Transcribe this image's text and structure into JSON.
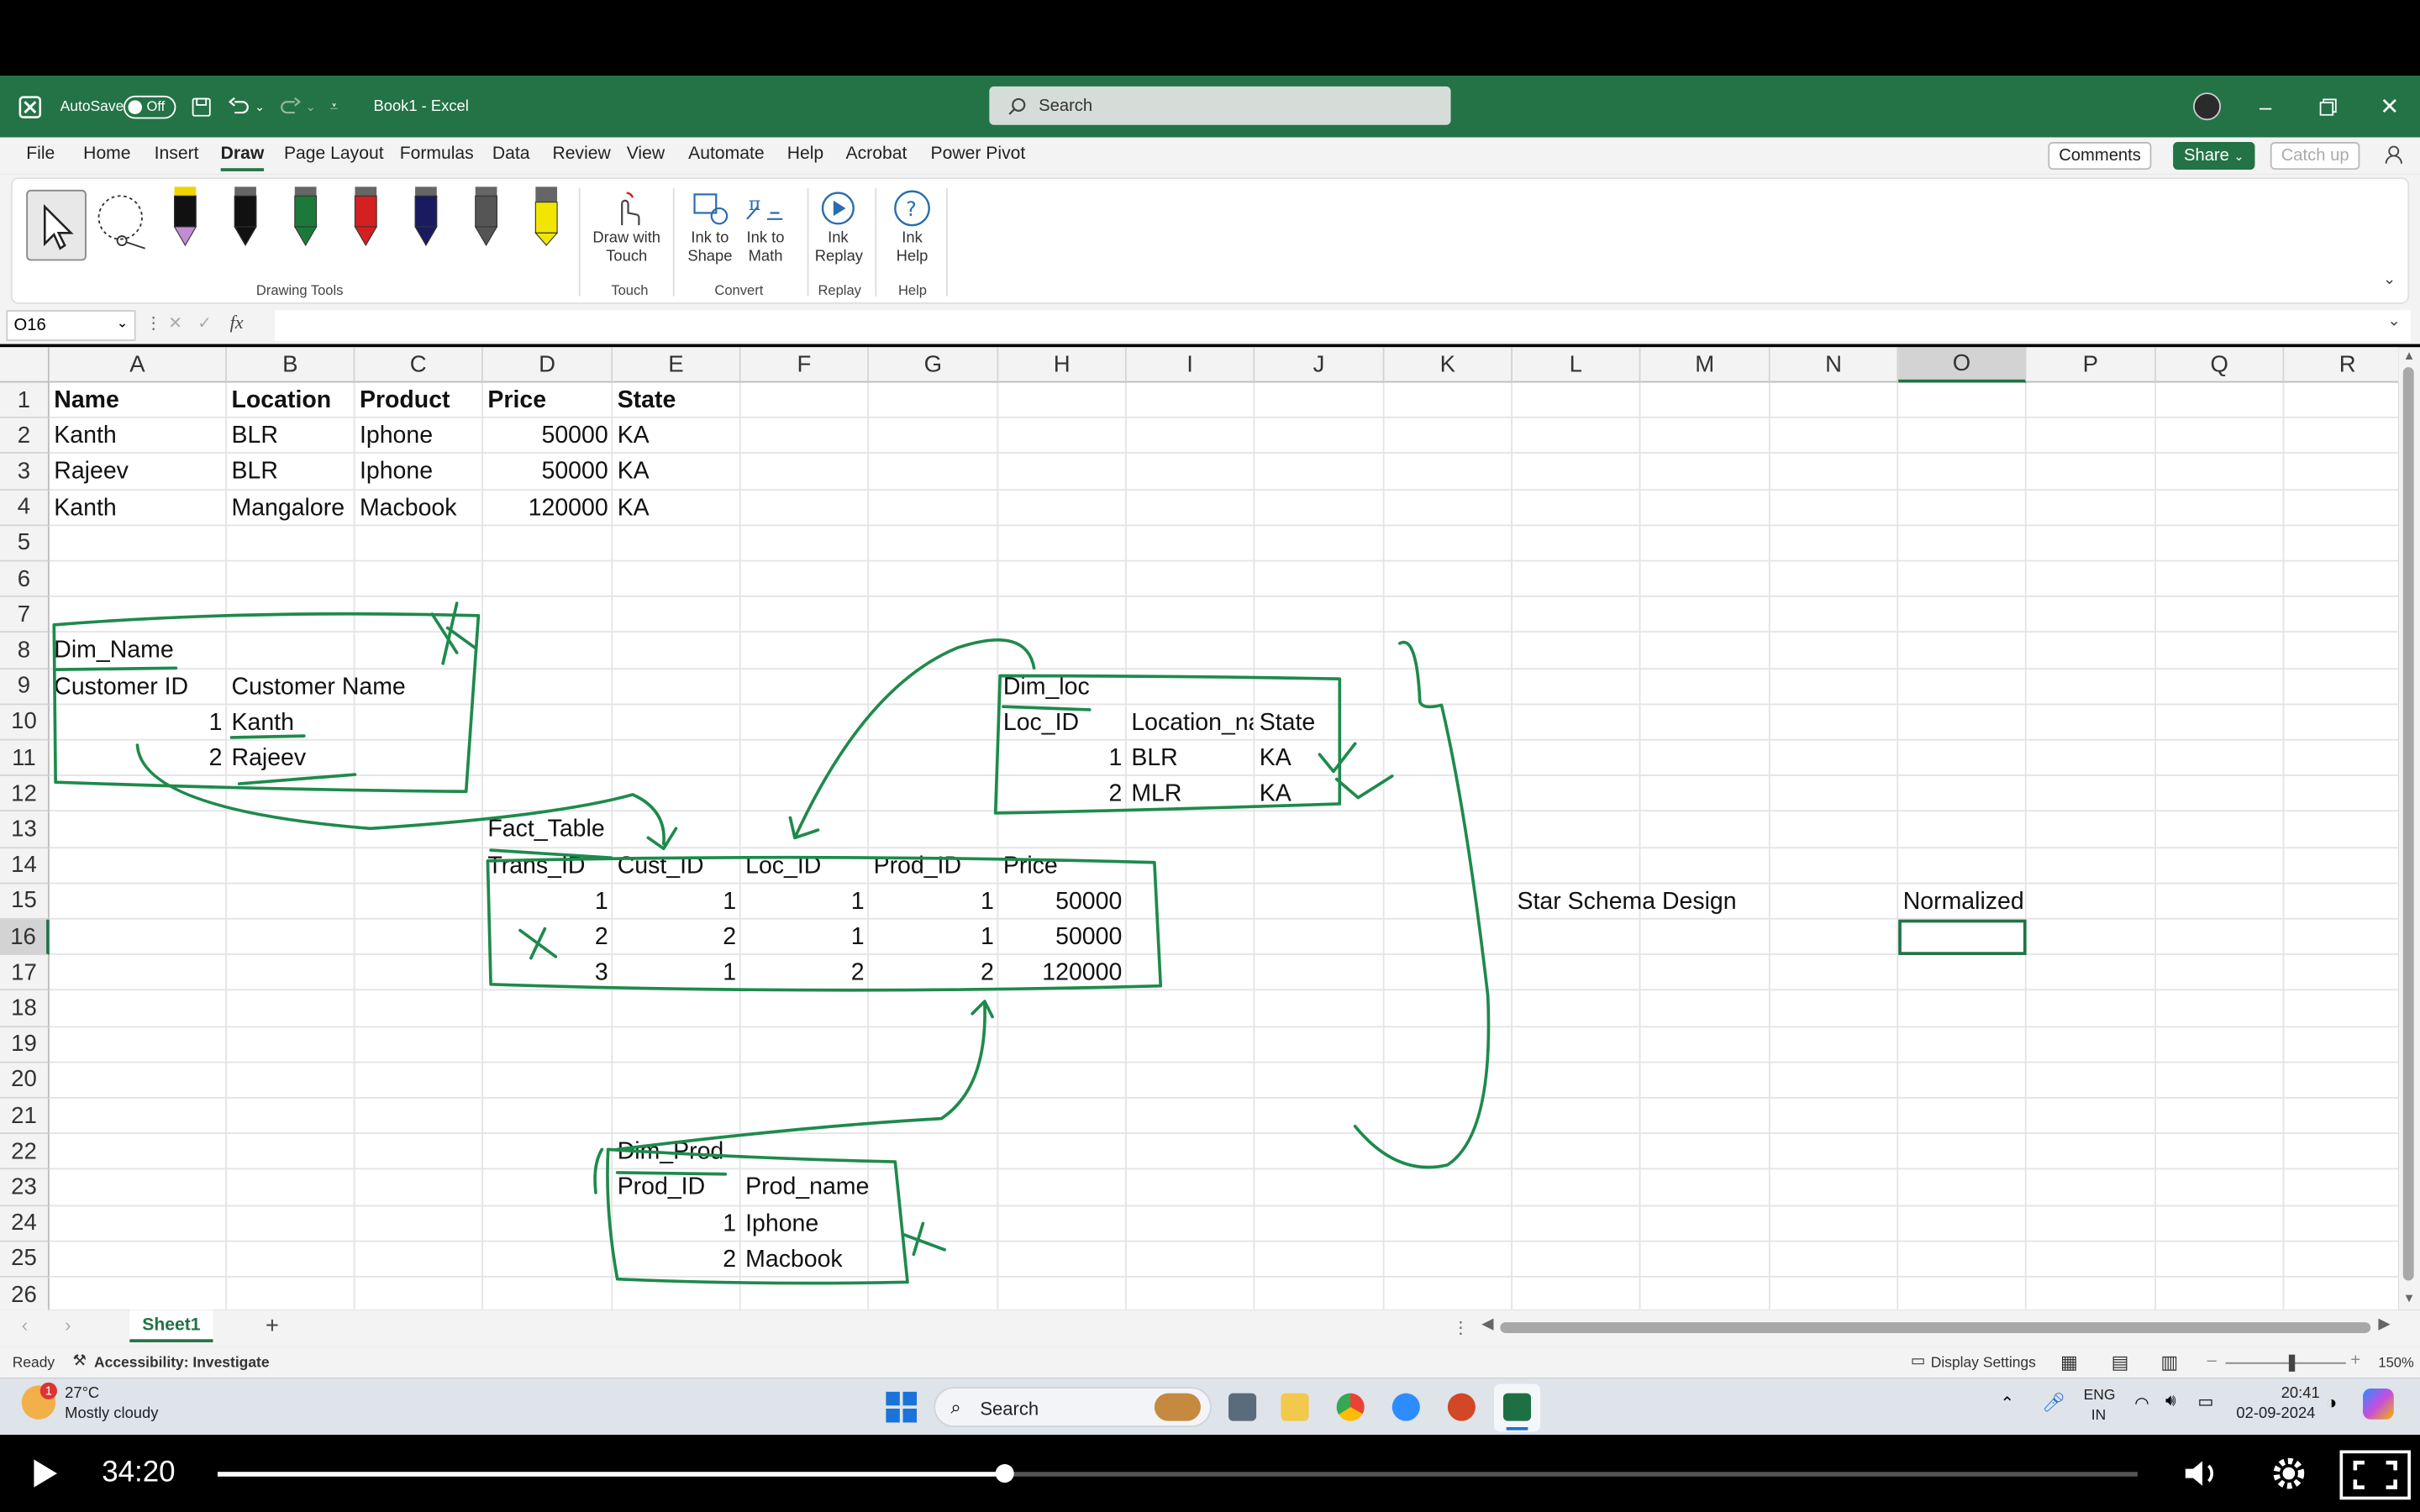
{
  "titlebar": {
    "autosave_label": "AutoSave",
    "autosave_state": "Off",
    "doc_title": "Book1  -  Excel",
    "search_placeholder": "Search"
  },
  "menu": {
    "items": [
      "File",
      "Home",
      "Insert",
      "Draw",
      "Page Layout",
      "Formulas",
      "Data",
      "Review",
      "View",
      "Automate",
      "Help",
      "Acrobat",
      "Power Pivot"
    ],
    "active": "Draw",
    "comments_label": "Comments",
    "share_label": "Share",
    "catchup_label": "Catch up"
  },
  "ribbon": {
    "drawing_tools_label": "Drawing Tools",
    "draw_with_touch": "Draw with Touch",
    "touch_group": "Touch",
    "ink_to_shape": "Ink to Shape",
    "ink_to_math": "Ink to Math",
    "convert_group": "Convert",
    "ink_replay": "Ink Replay",
    "replay_group": "Replay",
    "ink_help": "Ink Help",
    "help_group": "Help",
    "pen_colors": [
      "#111111",
      "#111111",
      "#1b7a3a",
      "#d42020",
      "#1a1a60",
      "#555555",
      "#f2e600"
    ]
  },
  "formula_bar": {
    "name_box": "O16",
    "fx_label": "fx",
    "content": ""
  },
  "columns": [
    "A",
    "B",
    "C",
    "D",
    "E",
    "F",
    "G",
    "H",
    "I",
    "J",
    "K",
    "L",
    "M",
    "N",
    "O",
    "P",
    "Q",
    "R"
  ],
  "rows": [
    "1",
    "2",
    "3",
    "4",
    "5",
    "6",
    "7",
    "8",
    "9",
    "10",
    "11",
    "12",
    "13",
    "14",
    "15",
    "16",
    "17",
    "18",
    "19",
    "20",
    "21",
    "22",
    "23",
    "24",
    "25",
    "26"
  ],
  "selected": {
    "column": "O",
    "row": "16"
  },
  "cells": {
    "A1": "Name",
    "B1": "Location",
    "C1": "Product",
    "D1": "Price",
    "E1": "State",
    "A2": "Kanth",
    "B2": "BLR",
    "C2": "Iphone",
    "D2": "50000",
    "E2": "KA",
    "A3": "Rajeev",
    "B3": "BLR",
    "C3": "Iphone",
    "D3": "50000",
    "E3": "KA",
    "A4": "Kanth",
    "B4": "Mangalore",
    "C4": "Macbook",
    "D4": "120000",
    "E4": "KA",
    "A8": "Dim_Name",
    "A9": "Customer ID",
    "B9": "Customer Name",
    "A10": "1",
    "B10": "Kanth",
    "A11": "2",
    "B11": "Rajeev",
    "H9": "Dim_loc",
    "H10": "Loc_ID",
    "I10": "Location_na",
    "J10": "State",
    "H11": "1",
    "I11": "BLR",
    "J11": "KA",
    "H12": "2",
    "I12": "MLR",
    "J12": "KA",
    "D13": "Fact_Table",
    "D14": "Trans_ID",
    "E14": "Cust_ID",
    "F14": "Loc_ID",
    "G14": "Prod_ID",
    "H14": "Price",
    "D15": "1",
    "E15": "1",
    "F15": "1",
    "G15": "1",
    "H15": "50000",
    "D16": "2",
    "E16": "2",
    "F16": "1",
    "G16": "1",
    "H16": "50000",
    "D17": "3",
    "E17": "1",
    "F17": "2",
    "G17": "2",
    "H17": "120000",
    "L15": "Star Schema Design",
    "O15": "Normalized",
    "E22": "Dim_Prod",
    "E23": "Prod_ID",
    "F23": "Prod_name",
    "E24": "1",
    "F24": "Iphone",
    "E25": "2",
    "F25": "Macbook"
  },
  "sheet": {
    "tab": "Sheet1",
    "add": "+"
  },
  "status": {
    "ready": "Ready",
    "accessibility": "Accessibility: Investigate",
    "display_settings": "Display Settings",
    "zoom": "150%"
  },
  "taskbar": {
    "temp": "27°C",
    "weather": "Mostly cloudy",
    "search": "Search",
    "lang1": "ENG",
    "lang2": "IN",
    "time": "20:41",
    "date": "02-09-2024",
    "notif_badge": "1"
  },
  "player": {
    "timestamp": "34:20",
    "progress": 0.41
  }
}
